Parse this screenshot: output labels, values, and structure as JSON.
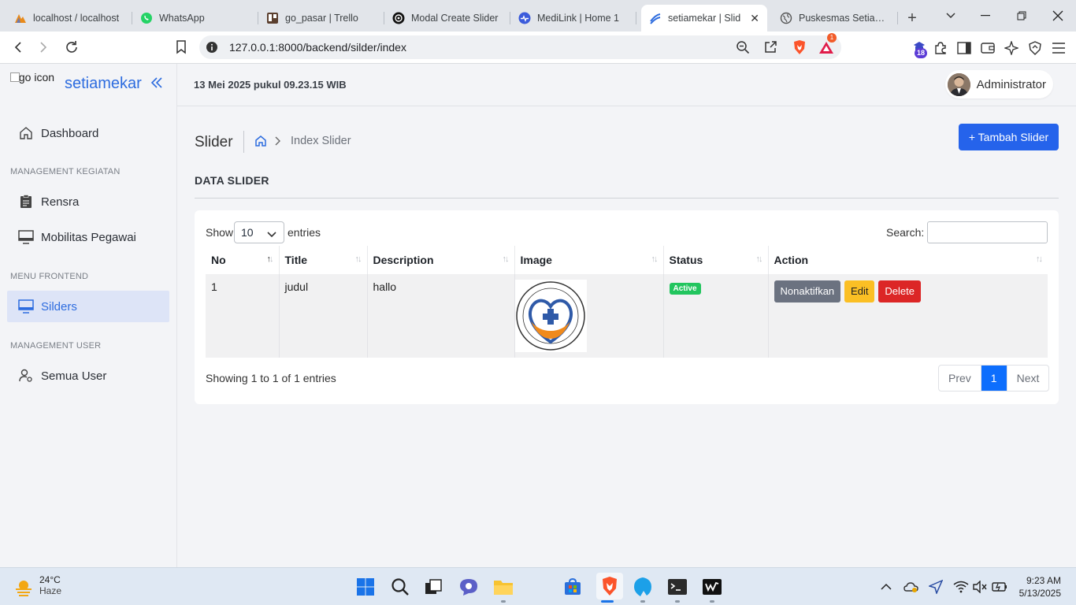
{
  "browser": {
    "tabs": [
      {
        "title": "localhost / localhost",
        "icon": "phpmyadmin-icon"
      },
      {
        "title": "WhatsApp",
        "icon": "whatsapp-icon"
      },
      {
        "title": "go_pasar | Trello",
        "icon": "trello-icon"
      },
      {
        "title": "Modal Create Slider",
        "icon": "openai-icon"
      },
      {
        "title": "MediLink | Home 1",
        "icon": "medilink-icon"
      },
      {
        "title": "setiamekar | Slid",
        "icon": "setiamekar-icon",
        "active": true
      },
      {
        "title": "Puskesmas Setiamek",
        "icon": "globe-icon"
      }
    ],
    "url": "127.0.0.1:8000/backend/silder/index",
    "notification_badge": "1",
    "extension_badge": "18"
  },
  "sidebar": {
    "logo_alt": "logo icon",
    "brand": "setiamekar",
    "dashboard": "Dashboard",
    "section_kegiatan": "MANAGEMENT KEGIATAN",
    "rensra": "Rensra",
    "mobilitas": "Mobilitas Pegawai",
    "section_frontend": "MENU FRONTEND",
    "sliders": "Silders",
    "section_user": "MANAGEMENT USER",
    "semua_user": "Semua User"
  },
  "header": {
    "datetime": "13 Mei 2025 pukul 09.23.15 WIB",
    "user_name": "Administrator"
  },
  "page": {
    "title": "Slider",
    "breadcrumb_current": "Index Slider",
    "add_button": "+ Tambah Slider",
    "section_title": "DATA SLIDER"
  },
  "table": {
    "show_label": "Show",
    "entries_value": "10",
    "entries_label": "entries",
    "search_label": "Search:",
    "search_value": "",
    "columns": [
      "No",
      "Title",
      "Description",
      "Image",
      "Status",
      "Action"
    ],
    "rows": [
      {
        "no": "1",
        "title": "judul",
        "description": "hallo",
        "status": "Active",
        "actions": [
          "Nonaktifkan",
          "Edit",
          "Delete"
        ]
      }
    ],
    "info": "Showing 1 to 1 of 1 entries",
    "pager": {
      "prev": "Prev",
      "current": "1",
      "next": "Next"
    }
  },
  "taskbar": {
    "temperature": "24°C",
    "condition": "Haze",
    "time": "9:23 AM",
    "date": "5/13/2025"
  },
  "colors": {
    "primary": "#2563eb",
    "brand": "#2d6cdf",
    "status_active": "#22c55e",
    "danger": "#dc2626",
    "warning": "#fbbf24"
  }
}
